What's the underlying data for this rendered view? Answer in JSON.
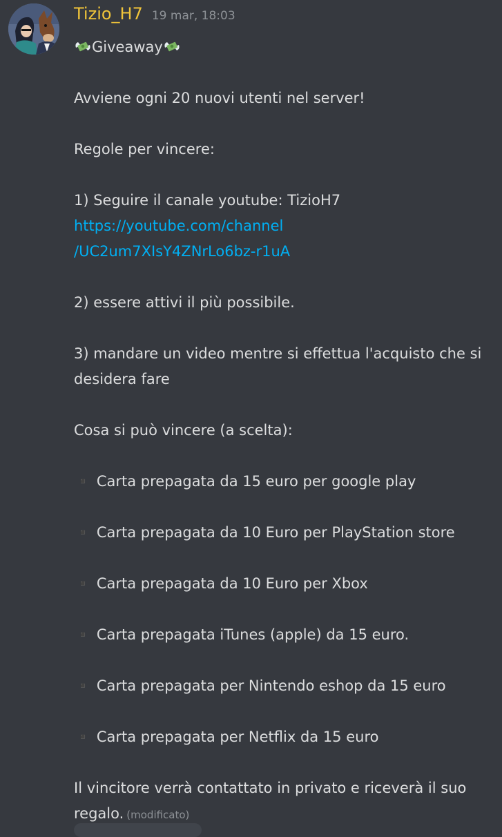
{
  "author": {
    "name": "Tizio_H7",
    "name_color": "#f0c43a",
    "timestamp": "19 mar, 18:03",
    "avatar_icon": "bojack-horseman-avatar"
  },
  "message": {
    "title_emoji": "money-with-wings-icon",
    "title": "Giveaway",
    "intro": "Avviene ogni 20 nuovi utenti nel server!",
    "rules_heading": "Regole per vincere:",
    "rule1": "1) Seguire il canale youtube: TizioH7",
    "link_line1": "https://youtube.com/channel",
    "link_line2": "/UC2um7XIsY4ZNrLo6bz-r1uA",
    "rule2": "2) essere attivi il più possibile.",
    "rule3_line1": "3) mandare un video mentre si effettua l'acquisto che si",
    "rule3_line2": "desidera fare",
    "prizes_heading": "Cosa si può vincere (a scelta):",
    "prizes": [
      "▪️ Carta prepagata da 15 euro per google play",
      "▪️ Carta prepagata da 10 Euro per PlayStation store",
      "▪️ Carta prepagata da 10 Euro per Xbox",
      "▪️ Carta prepagata iTunes (apple) da 15 euro.",
      "▪️ Carta prepagata per Nintendo eshop da 15 euro",
      "▪️ Carta prepagata per Netflix da 15 euro"
    ],
    "closing_line1": "Il vincitore verrà contattato in privato e riceverà il suo",
    "closing_line2": "regalo.",
    "edited_label": "(modificato)"
  },
  "colors": {
    "background": "#36393f",
    "text": "#dcddde",
    "link": "#00b0f4",
    "muted": "#8e9297"
  }
}
